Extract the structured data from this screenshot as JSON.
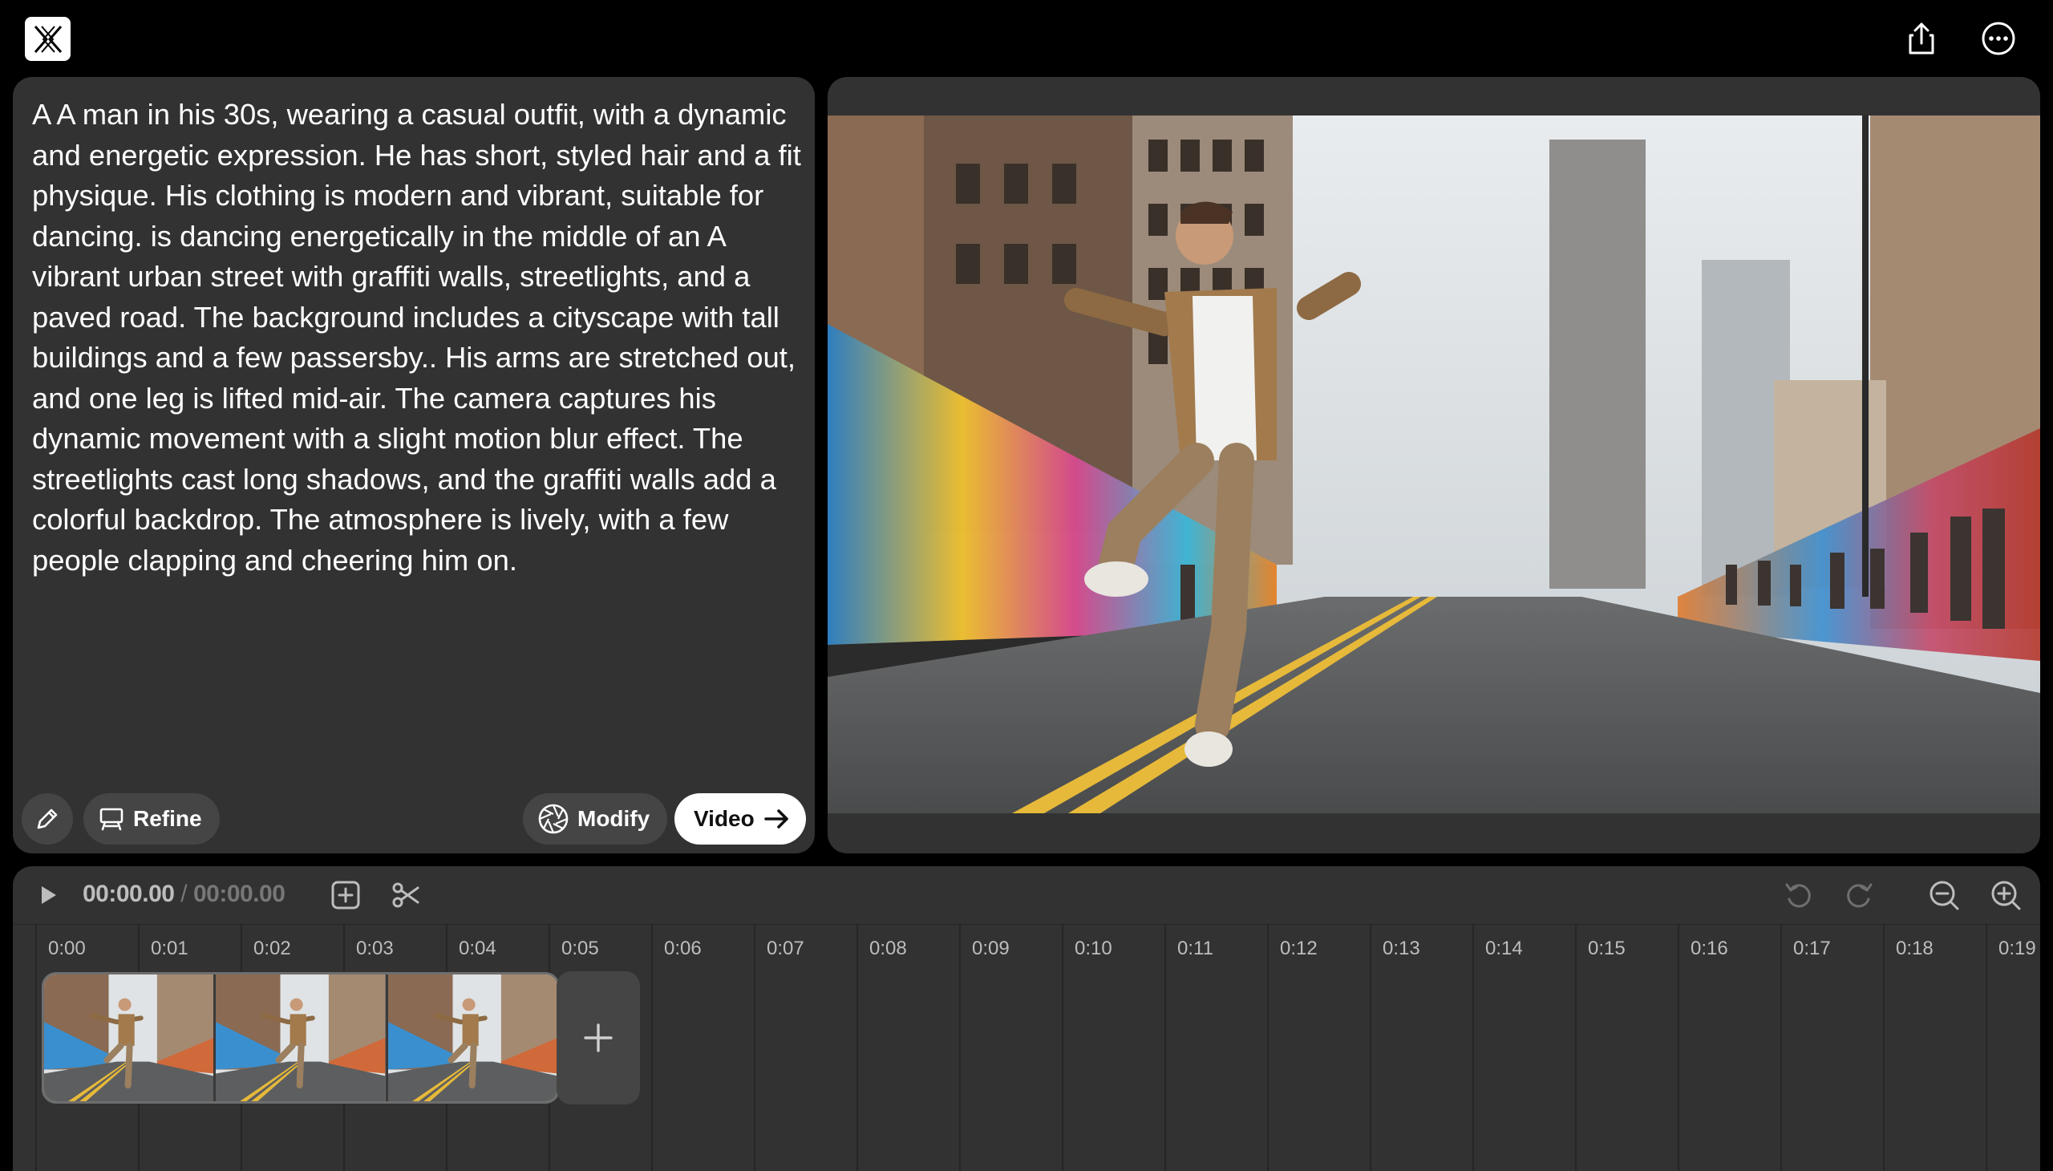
{
  "app": {
    "logo_icon": "app-logo-icon",
    "share_icon": "share-icon",
    "more_icon": "more-options-icon"
  },
  "prompt": {
    "text": "A A man in his 30s, wearing a casual outfit, with a dynamic and energetic expression. He has short, styled hair and a fit physique. His clothing is modern and vibrant, suitable for dancing. is dancing energetically in the middle of an A vibrant urban street with graffiti walls, streetlights, and a paved road. The background includes a cityscape with tall buildings and a few passersby.. His arms are stretched out, and one leg is lifted mid-air. The camera captures his dynamic movement with a slight motion blur effect. The streetlights cast long shadows, and the graffiti walls add a colorful backdrop. The atmosphere is lively, with a few people clapping and cheering him on.",
    "buttons": {
      "edit_icon": "pencil-icon",
      "refine_label": "Refine",
      "modify_label": "Modify",
      "video_label": "Video"
    }
  },
  "timeline": {
    "current_time": "00:00.00",
    "separator": "/",
    "total_time": "00:00.00",
    "ticks": [
      "0:00",
      "0:01",
      "0:02",
      "0:03",
      "0:04",
      "0:05",
      "0:06",
      "0:07",
      "0:08",
      "0:09",
      "0:10",
      "0:11",
      "0:12",
      "0:13",
      "0:14",
      "0:15",
      "0:16",
      "0:17",
      "0:18",
      "0:19"
    ],
    "clip_frames": 3
  },
  "colors": {
    "background": "#000000",
    "panel": "#323232",
    "button": "#454545",
    "accent_white": "#ffffff",
    "road_line": "#e6b93a"
  }
}
